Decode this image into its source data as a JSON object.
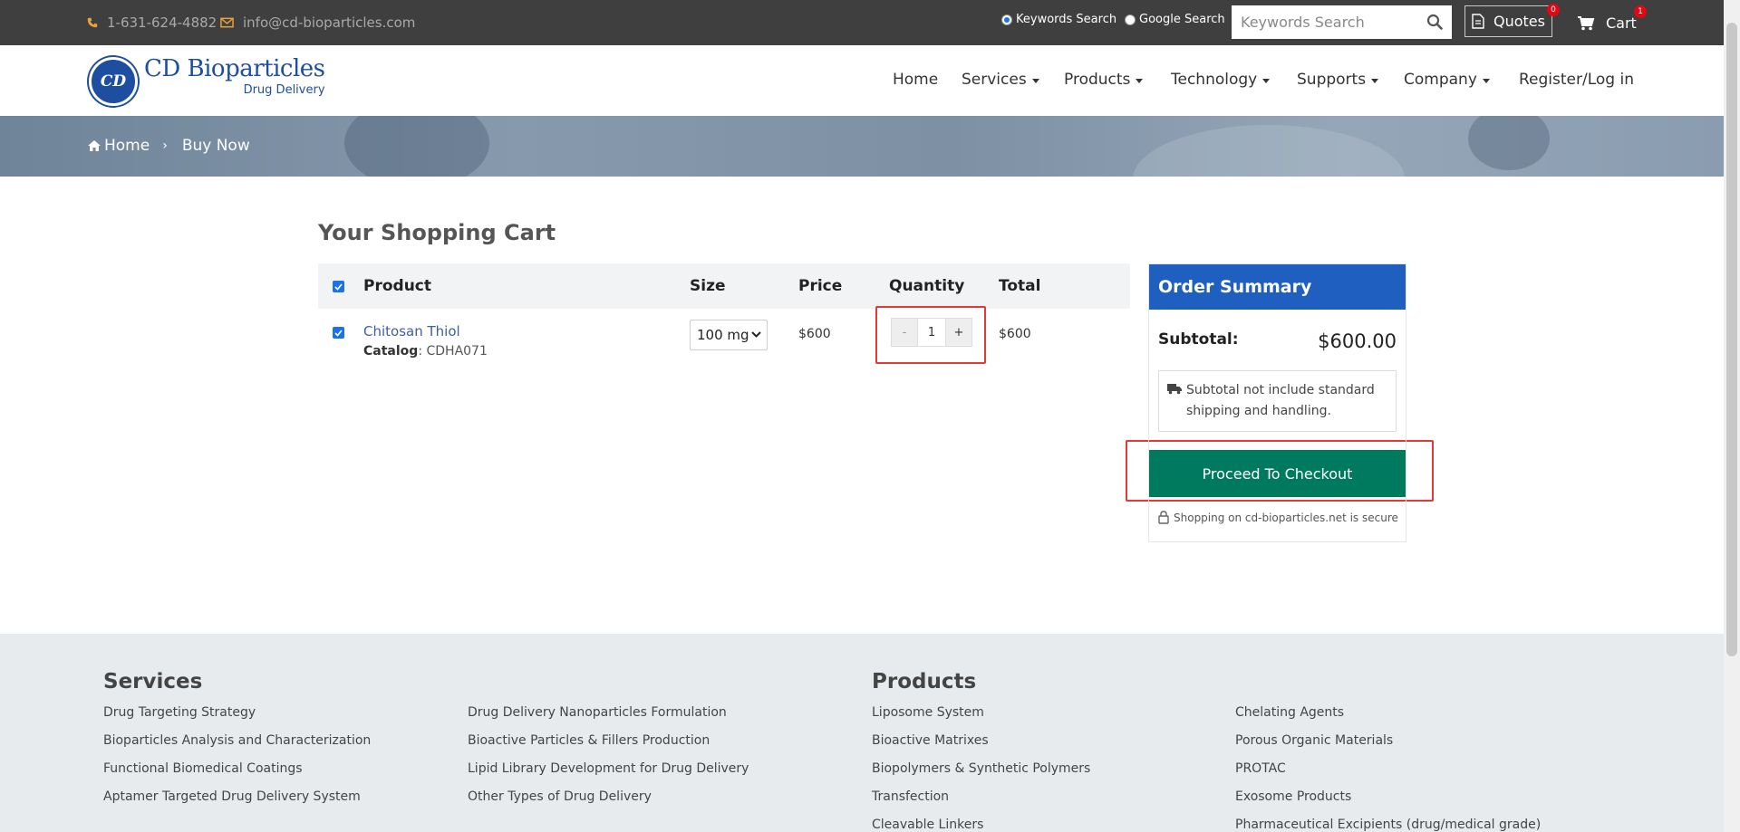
{
  "topbar": {
    "phone": "1-631-624-4882",
    "email": "info@cd-bioparticles.com",
    "search_options": [
      "Keywords Search",
      "Google Search"
    ],
    "search_placeholder": "Keywords Search",
    "quotes_label": "Quotes",
    "quotes_count": "0",
    "cart_label": "Cart",
    "cart_count": "1"
  },
  "logo": {
    "name": "CD Bioparticles",
    "sub": "Drug Delivery",
    "mark": "CD"
  },
  "nav": [
    {
      "label": "Home",
      "dropdown": false
    },
    {
      "label": "Services",
      "dropdown": true
    },
    {
      "label": "Products",
      "dropdown": true
    },
    {
      "label": "Technology",
      "dropdown": true
    },
    {
      "label": "Supports",
      "dropdown": true
    },
    {
      "label": "Company",
      "dropdown": true
    },
    {
      "label": "Register/Log in",
      "dropdown": false
    }
  ],
  "breadcrumb": {
    "home": "Home",
    "sep": "›",
    "current": "Buy Now"
  },
  "cart": {
    "title": "Your Shopping Cart",
    "columns": [
      "Product",
      "Size",
      "Price",
      "Quantity",
      "Total"
    ],
    "items": [
      {
        "name": "Chitosan Thiol",
        "catalog_label": "Catalog",
        "catalog": "CDHA071",
        "size": "100 mg",
        "price": "$600",
        "quantity": "1",
        "total": "$600"
      }
    ],
    "qty_minus": "-",
    "qty_plus": "+"
  },
  "summary": {
    "title": "Order Summary",
    "subtotal_label": "Subtotal:",
    "subtotal_value": "$600.00",
    "note": "Subtotal not include standard shipping and handling.",
    "checkout_label": "Proceed To Checkout",
    "secure_text": "Shopping on cd-bioparticles.net is secure"
  },
  "footer": {
    "services_title": "Services",
    "services_col1": [
      "Drug Targeting Strategy",
      "Bioparticles Analysis and Characterization",
      "Functional Biomedical Coatings",
      "Aptamer Targeted Drug Delivery System"
    ],
    "services_col2": [
      "Drug Delivery Nanoparticles Formulation",
      "Bioactive Particles & Fillers Production",
      "Lipid Library Development for Drug Delivery",
      "Other Types of Drug Delivery"
    ],
    "products_title": "Products",
    "products_col1": [
      "Liposome System",
      "Bioactive Matrixes",
      "Biopolymers & Synthetic Polymers",
      "Transfection",
      "Cleavable Linkers"
    ],
    "products_col2": [
      "Chelating Agents",
      "Porous Organic Materials",
      "PROTAC",
      "Exosome Products",
      "Pharmaceutical Excipients (drug/medical grade)"
    ]
  },
  "colors": {
    "topbar_bg": "#3f3f3f",
    "accent_blue": "#1e5fbf",
    "checkout_green": "#007a5e",
    "highlight_red": "#e53935",
    "link_blue": "#3d5ea8"
  }
}
